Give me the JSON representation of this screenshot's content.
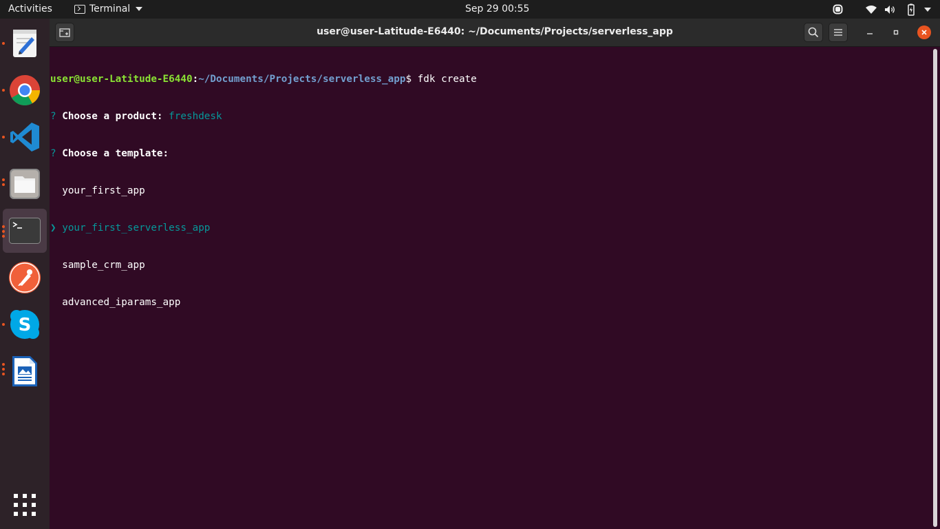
{
  "topbar": {
    "activities": "Activities",
    "app_name": "Terminal",
    "clock": "Sep 29  00:55"
  },
  "window": {
    "title": "user@user-Latitude-E6440: ~/Documents/Projects/serverless_app"
  },
  "terminal": {
    "prompt_user": "user@user-Latitude-E6440",
    "prompt_sep": ":",
    "prompt_path": "~/Documents/Projects/serverless_app",
    "prompt_symbol": "$",
    "command": " fdk create",
    "q1_mark": "?",
    "q1_label": " Choose a product: ",
    "q1_answer": "freshdesk",
    "q2_mark": "?",
    "q2_label": " Choose a template:",
    "pointer": "❯",
    "options": [
      "  your_first_app",
      "your_first_serverless_app",
      "  sample_crm_app",
      "  advanced_iparams_app"
    ]
  },
  "dock": {
    "items": [
      {
        "icon": "text-editor-icon",
        "running": true
      },
      {
        "icon": "chrome-icon",
        "running": true
      },
      {
        "icon": "vscode-icon",
        "running": true
      },
      {
        "icon": "files-icon",
        "running": true
      },
      {
        "icon": "terminal-icon",
        "running": true,
        "active": true
      },
      {
        "icon": "postman-icon",
        "running": false
      },
      {
        "icon": "skype-icon",
        "running": true
      },
      {
        "icon": "libreoffice-writer-icon",
        "running": true
      },
      {
        "icon": "show-applications-icon",
        "running": false
      }
    ]
  },
  "colors": {
    "terminal_bg": "#300a24",
    "prompt_user": "#8ae234",
    "prompt_path": "#729fcf",
    "highlight": "#06989a",
    "accent": "#e95420"
  }
}
